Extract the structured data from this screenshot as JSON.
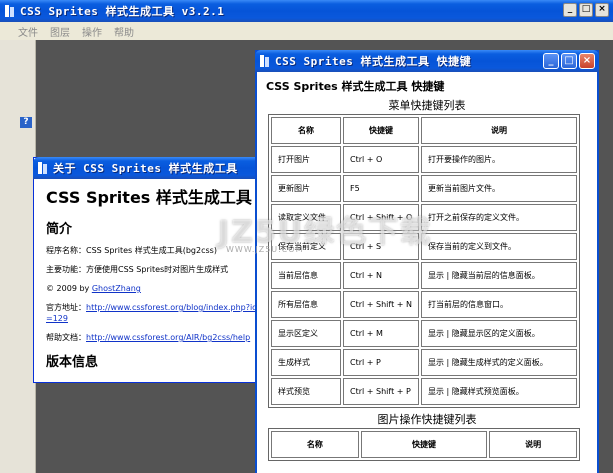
{
  "main_window": {
    "title": "CSS Sprites 样式生成工具 v3.2.1",
    "menu": [
      "文件",
      "图层",
      "操作",
      "帮助"
    ],
    "sidebar_help": "?"
  },
  "about": {
    "title": "关于 CSS Sprites 样式生成工具",
    "heading": "CSS Sprites 样式生成工具",
    "intro_title": "简介",
    "program_name": "程序名称：CSS Sprites 样式生成工具(bg2css)",
    "function": "主要功能：方便使用CSS Sprites时对图片生成样式",
    "copyright_prefix": "© 2009 by ",
    "author": "GhostZhang",
    "official_label": "官方地址：",
    "official_url": "http://www.cssforest.org/blog/index.php?id=129",
    "help_label": "帮助文档：",
    "help_url": "http://www.cssforest.org/AIR/bg2css/help",
    "version_title": "版本信息"
  },
  "shortcuts": {
    "title": "CSS Sprites 样式生成工具 快捷键",
    "heading": "CSS Sprites 样式生成工具 快捷键",
    "menu_section": "菜单快捷键列表",
    "image_section": "图片操作快捷键列表",
    "columns": [
      "名称",
      "快捷键",
      "说明"
    ],
    "menu_rows": [
      {
        "name": "打开图片",
        "key": "Ctrl + O",
        "desc": "打开要操作的图片。"
      },
      {
        "name": "更新图片",
        "key": "F5",
        "desc": "更新当前图片文件。"
      },
      {
        "name": "读取定义文件",
        "key": "Ctrl + Shift + O",
        "desc": "打开之前保存的定义文件。"
      },
      {
        "name": "保存当前定义",
        "key": "Ctrl + S",
        "desc": "保存当前的定义到文件。"
      },
      {
        "name": "当前层信息",
        "key": "Ctrl + N",
        "desc": "显示 | 隐藏当前层的信息面板。"
      },
      {
        "name": "所有层信息",
        "key": "Ctrl + Shift + N",
        "desc": "打当前层的信息窗口。"
      },
      {
        "name": "显示区定义",
        "key": "Ctrl + M",
        "desc": "显示 | 隐藏显示区的定义面板。"
      },
      {
        "name": "生成样式",
        "key": "Ctrl + P",
        "desc": "显示 | 隐藏生成样式的定义面板。"
      },
      {
        "name": "样式预览",
        "key": "Ctrl + Shift + P",
        "desc": "显示 | 隐藏样式预览面板。"
      }
    ]
  },
  "watermark": {
    "text": "JZ5U绿色下载",
    "sub": "WWW.JZ5U.COM"
  }
}
